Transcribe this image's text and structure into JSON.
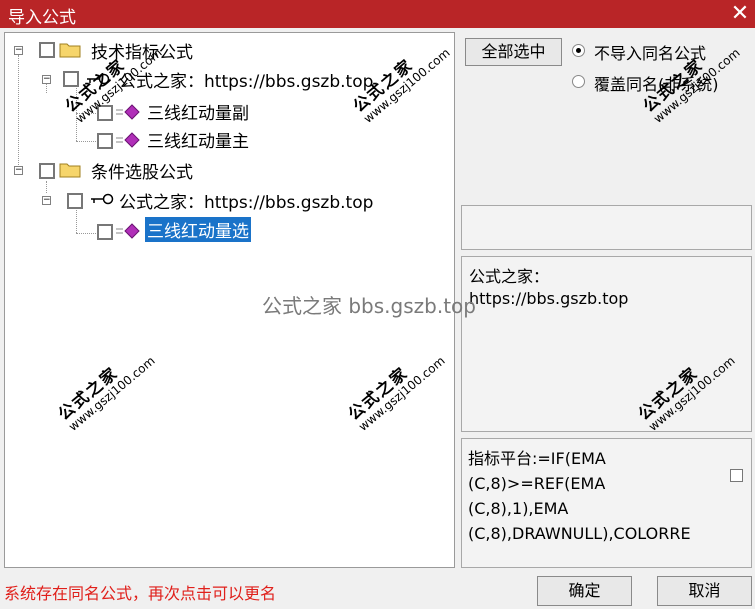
{
  "window": {
    "title": "导入公式",
    "close_glyph": "✕"
  },
  "tree": {
    "group1": {
      "label": "技术指标公式",
      "child": {
        "label": "公式之家：https://bbs.gszb.top",
        "leaves": [
          "三线红动量副",
          "三线红动量主"
        ]
      }
    },
    "group2": {
      "label": "条件选股公式",
      "child": {
        "label": "公式之家：https://bbs.gszb.top",
        "leaves": [
          "三线红动量选"
        ]
      }
    }
  },
  "actions": {
    "select_all": "全部选中",
    "radio_no_import": "不导入同名公式",
    "radio_overwrite": "覆盖同名(非系统)",
    "selected_option": "radio_no_import"
  },
  "info": {
    "line1": "公式之家：",
    "line2": "https://bbs.gszb.top"
  },
  "code": {
    "lines": [
      "指标平台:=IF(EMA",
      "(C,8)>=REF(EMA",
      "(C,8),1),EMA",
      "(C,8),DRAWNULL),COLORRE"
    ]
  },
  "watermark": {
    "big": "公式之家",
    "small": "www.gszj100.com",
    "center_text": "公式之家 bbs.gszb.top"
  },
  "status": {
    "message": "系统存在同名公式，再次点击可以更名"
  },
  "buttons": {
    "ok": "确定",
    "cancel": "取消"
  },
  "colors": {
    "title_bar": "#b92527",
    "selection": "#1a73c9",
    "status_text": "#e0201b"
  }
}
